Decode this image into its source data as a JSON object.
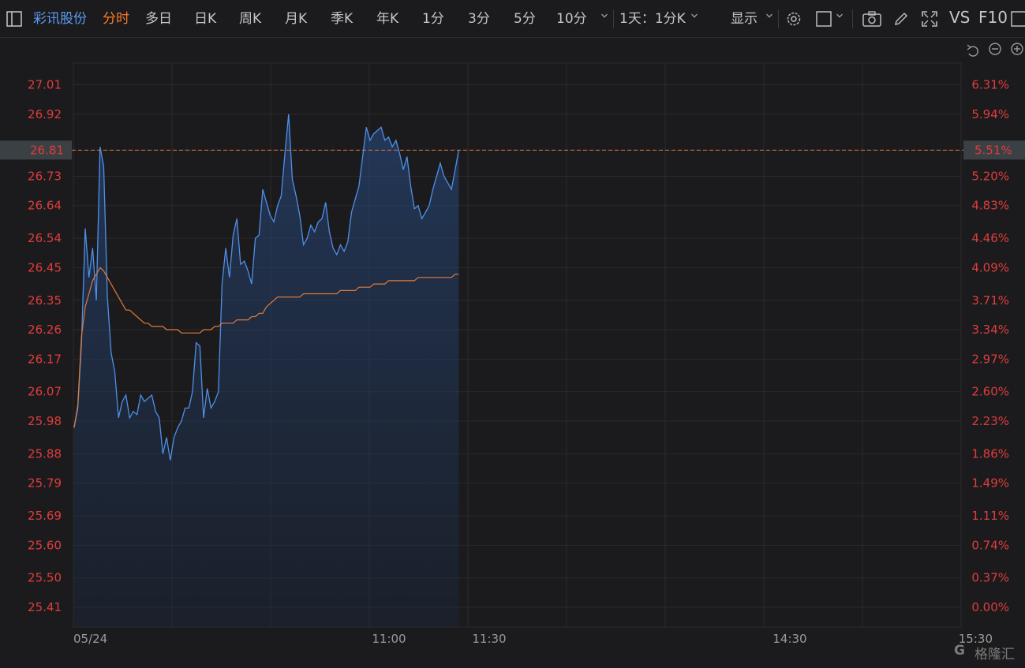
{
  "toolbar": {
    "stock_name": "彩讯股份",
    "tabs": [
      "分时",
      "多日",
      "日K",
      "周K",
      "月K",
      "季K",
      "年K",
      "1分",
      "3分",
      "5分",
      "10分"
    ],
    "active_tab": "分时",
    "more_icon": "chevron-down-icon",
    "combo_label": "1天：1分K",
    "display_label": "显示",
    "vs_label": "VS",
    "f10_label": "F10",
    "icons": [
      "settings-gear-icon",
      "square-icon",
      "camera-icon",
      "pencil-icon",
      "fullscreen-icon",
      "window-icon"
    ]
  },
  "chart_controls": {
    "icons": [
      "undo-icon",
      "zoom-out-icon",
      "zoom-in-icon"
    ]
  },
  "colors": {
    "price_line": "#4f8fe8",
    "avg_line": "#e07a3a",
    "axis_text": "#e03c3c",
    "background": "#1b1b1d",
    "grid": "#2b2b2e"
  },
  "chart_data": {
    "type": "line",
    "x_label_date": "05/24",
    "x_ticks": [
      "11:00",
      "11:30",
      "14:30",
      "15:30"
    ],
    "y_ticks": [
      "27.01",
      "26.92",
      "26.81",
      "26.73",
      "26.64",
      "26.54",
      "26.45",
      "26.35",
      "26.26",
      "26.17",
      "26.07",
      "25.98",
      "25.88",
      "25.79",
      "25.69",
      "25.60",
      "25.50",
      "25.41"
    ],
    "pct_ticks": [
      "6.31%",
      "5.94%",
      "5.51%",
      "5.20%",
      "4.83%",
      "4.46%",
      "4.09%",
      "3.71%",
      "3.34%",
      "2.97%",
      "2.60%",
      "2.23%",
      "1.86%",
      "1.49%",
      "1.11%",
      "0.74%",
      "0.37%",
      "0.00%"
    ],
    "ylim": [
      25.41,
      27.01
    ],
    "current_price": "26.81",
    "current_pct": "5.51%",
    "minutes_total": 240,
    "series": [
      {
        "role": "price",
        "values": [
          25.96,
          26.02,
          26.22,
          26.57,
          26.42,
          26.51,
          26.35,
          26.82,
          26.76,
          26.36,
          26.19,
          26.13,
          25.99,
          26.04,
          26.06,
          25.99,
          26.01,
          26.0,
          26.06,
          26.04,
          26.05,
          26.06,
          26.01,
          25.99,
          25.88,
          25.93,
          25.86,
          25.93,
          25.96,
          25.98,
          26.02,
          26.02,
          26.07,
          26.22,
          26.21,
          25.99,
          26.08,
          26.02,
          26.04,
          26.07,
          26.4,
          26.51,
          26.42,
          26.55,
          26.6,
          26.46,
          26.47,
          26.44,
          26.4,
          26.54,
          26.55,
          26.69,
          26.65,
          26.61,
          26.59,
          26.64,
          26.67,
          26.8,
          26.92,
          26.72,
          26.67,
          26.61,
          26.52,
          26.54,
          26.58,
          26.56,
          26.59,
          26.6,
          26.65,
          26.56,
          26.51,
          26.49,
          26.52,
          26.5,
          26.53,
          26.62,
          26.66,
          26.7,
          26.79,
          26.88,
          26.84,
          26.86,
          26.87,
          26.88,
          26.84,
          26.85,
          26.82,
          26.84,
          26.8,
          26.75,
          26.79,
          26.7,
          26.63,
          26.64,
          26.6,
          26.62,
          26.64,
          26.69,
          26.73,
          26.77,
          26.73,
          26.71,
          26.69,
          26.75,
          26.81
        ]
      },
      {
        "role": "average",
        "values": [
          25.96,
          26.03,
          26.24,
          26.33,
          26.37,
          26.41,
          26.43,
          26.45,
          26.44,
          26.42,
          26.4,
          26.38,
          26.36,
          26.34,
          26.32,
          26.32,
          26.31,
          26.3,
          26.29,
          26.28,
          26.28,
          26.27,
          26.27,
          26.27,
          26.27,
          26.26,
          26.26,
          26.26,
          26.26,
          26.25,
          26.25,
          26.25,
          26.25,
          26.25,
          26.25,
          26.26,
          26.26,
          26.26,
          26.27,
          26.27,
          26.28,
          26.28,
          26.28,
          26.28,
          26.29,
          26.29,
          26.29,
          26.29,
          26.3,
          26.3,
          26.31,
          26.31,
          26.33,
          26.34,
          26.35,
          26.36,
          26.36,
          26.36,
          26.36,
          26.36,
          26.36,
          26.36,
          26.37,
          26.37,
          26.37,
          26.37,
          26.37,
          26.37,
          26.37,
          26.37,
          26.37,
          26.37,
          26.38,
          26.38,
          26.38,
          26.38,
          26.38,
          26.39,
          26.39,
          26.39,
          26.39,
          26.4,
          26.4,
          26.4,
          26.4,
          26.41,
          26.41,
          26.41,
          26.41,
          26.41,
          26.41,
          26.41,
          26.41,
          26.42,
          26.42,
          26.42,
          26.42,
          26.42,
          26.42,
          26.42,
          26.42,
          26.42,
          26.42,
          26.43,
          26.43
        ]
      }
    ]
  },
  "watermark": {
    "logo_letter": "G",
    "text": "格隆汇"
  }
}
